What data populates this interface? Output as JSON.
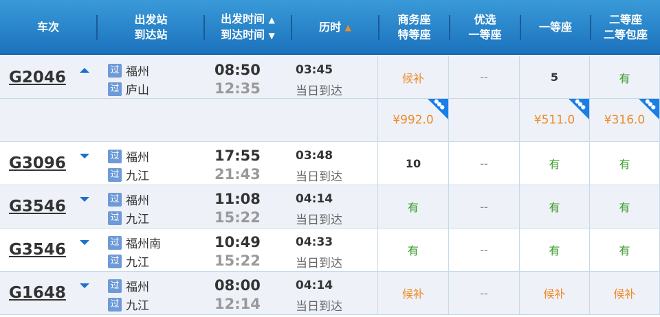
{
  "header": {
    "train": "车次",
    "station": [
      "出发站",
      "到达站"
    ],
    "time": [
      "出发时间",
      "到达时间"
    ],
    "duration": "历时",
    "business": [
      "商务座",
      "特等座"
    ],
    "premium": [
      "优选",
      "一等座"
    ],
    "first": "一等座",
    "second": [
      "二等座",
      "二等包座"
    ]
  },
  "badge": "过",
  "colors": {
    "header": "#2a86cc",
    "orange": "#f08a24",
    "green": "#3a9a2a",
    "row_alt": "#eef1f8"
  },
  "trains": [
    {
      "no": "G2046",
      "expanded": true,
      "from": "福州",
      "to": "庐山",
      "dep": "08:50",
      "arr": "12:35",
      "dur": "03:45",
      "arr_day": "当日到达",
      "business": "候补",
      "premium": "--",
      "first": "5",
      "second": "有",
      "prices": {
        "business": "¥992.0",
        "first": "¥511.0",
        "second": "¥316.0"
      }
    },
    {
      "no": "G3096",
      "expanded": false,
      "from": "福州",
      "to": "九江",
      "dep": "17:55",
      "arr": "21:43",
      "dur": "03:48",
      "arr_day": "当日到达",
      "business": "10",
      "premium": "--",
      "first": "有",
      "second": "有"
    },
    {
      "no": "G3546",
      "expanded": false,
      "from": "福州",
      "to": "九江",
      "dep": "11:08",
      "arr": "15:22",
      "dur": "04:14",
      "arr_day": "当日到达",
      "business": "有",
      "premium": "--",
      "first": "有",
      "second": "有"
    },
    {
      "no": "G3546",
      "expanded": false,
      "from": "福州南",
      "to": "九江",
      "dep": "10:49",
      "arr": "15:22",
      "dur": "04:33",
      "arr_day": "当日到达",
      "business": "有",
      "premium": "--",
      "first": "有",
      "second": "有"
    },
    {
      "no": "G1648",
      "expanded": false,
      "from": "福州",
      "to": "九江",
      "dep": "08:00",
      "arr": "12:14",
      "dur": "04:14",
      "arr_day": "当日到达",
      "business": "候补",
      "premium": "--",
      "first": "候补",
      "second": "候补"
    }
  ]
}
